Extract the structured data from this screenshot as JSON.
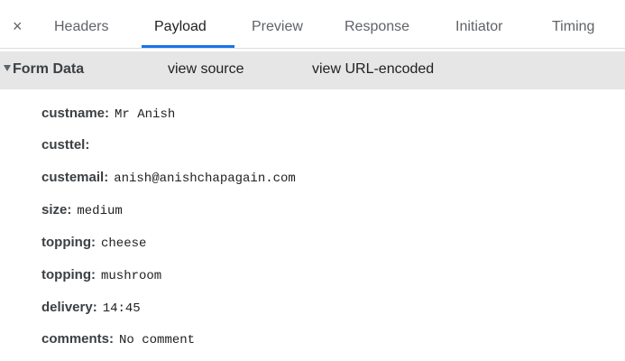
{
  "tabs": {
    "close": "×",
    "items": [
      "Headers",
      "Payload",
      "Preview",
      "Response",
      "Initiator",
      "Timing"
    ],
    "active": "Payload"
  },
  "section": {
    "title": "Form Data",
    "view_source": "view source",
    "view_url_encoded": "view URL-encoded"
  },
  "form": {
    "rows": [
      {
        "key": "custname:",
        "value": "Mr Anish"
      },
      {
        "key": "custtel:",
        "value": ""
      },
      {
        "key": "custemail:",
        "value": "anish@anishchapagain.com"
      },
      {
        "key": "size:",
        "value": "medium"
      },
      {
        "key": "topping:",
        "value": "cheese"
      },
      {
        "key": "topping:",
        "value": "mushroom"
      },
      {
        "key": "delivery:",
        "value": "14:45"
      },
      {
        "key": "comments:",
        "value": "No comment"
      }
    ]
  },
  "colors": {
    "accent": "#1a73e8",
    "header_bg": "#e6e6e6"
  }
}
